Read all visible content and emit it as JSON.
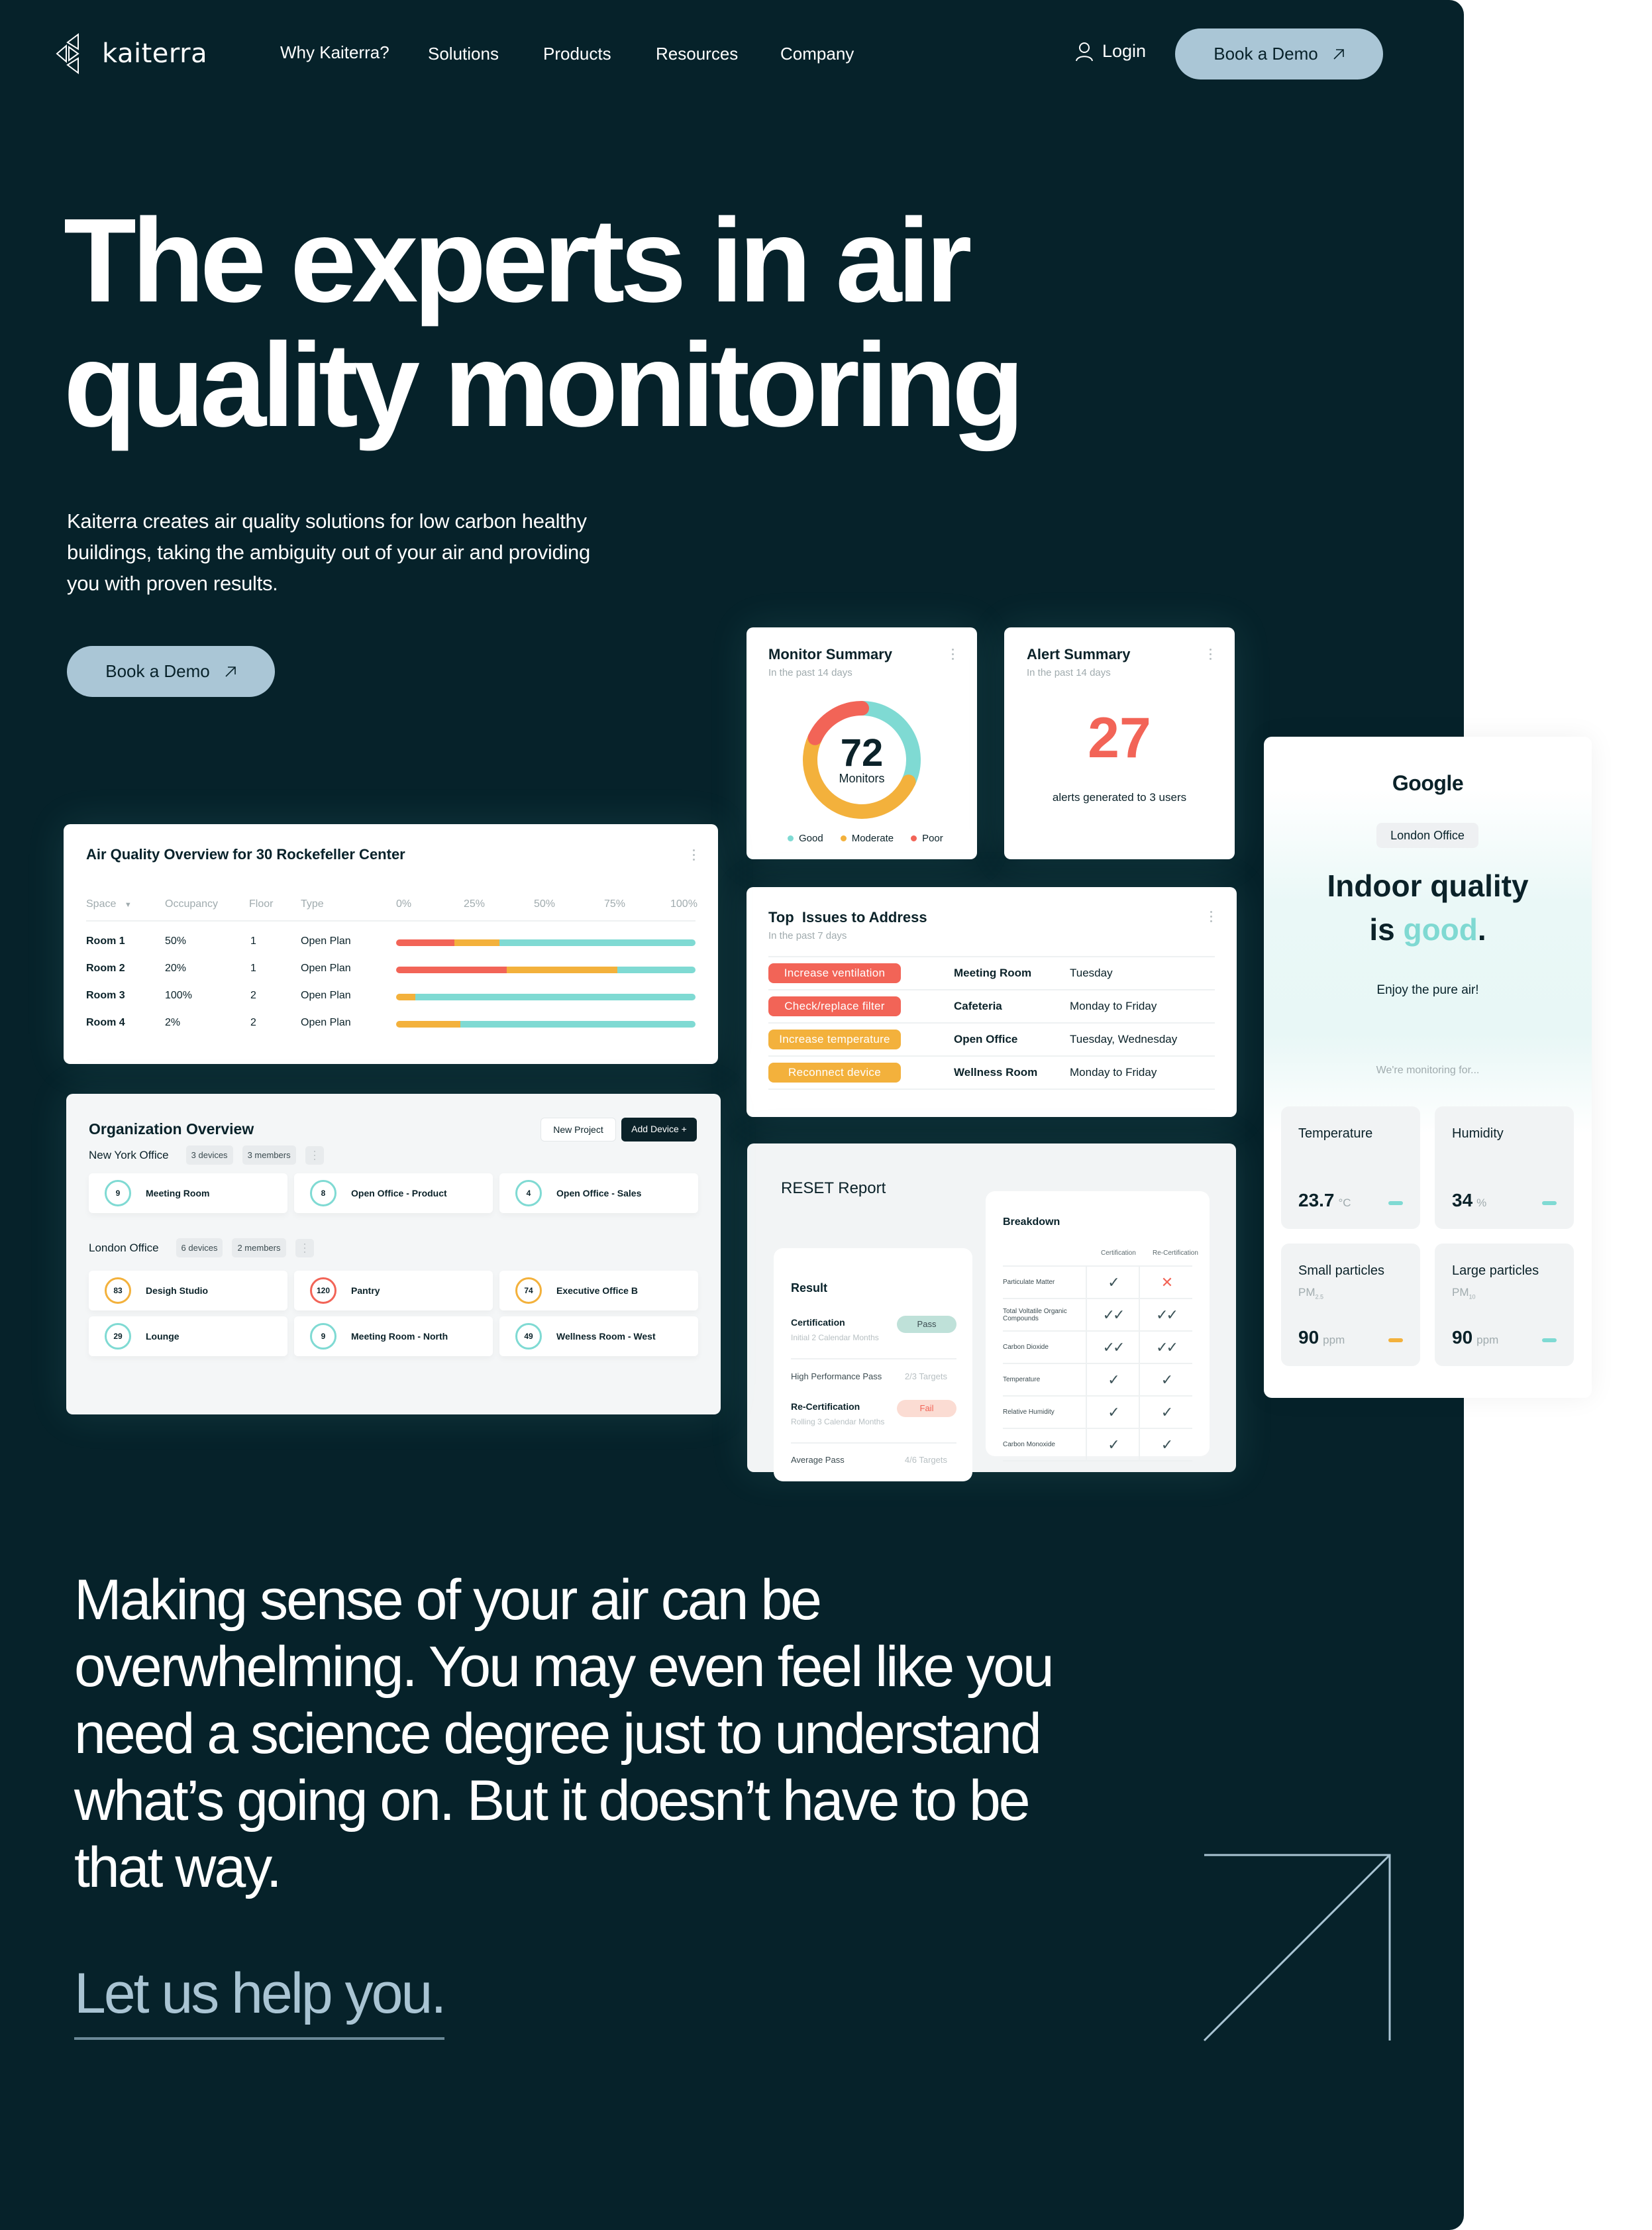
{
  "nav": {
    "brand": "kaiterra",
    "links": [
      "Why Kaiterra?",
      "Solutions",
      "Products",
      "Resources",
      "Company"
    ],
    "login": "Login",
    "cta": "Book a Demo"
  },
  "hero": {
    "title_line1": "The experts in air",
    "title_line2": "quality monitoring",
    "subtitle": "Kaiterra creates air quality solutions for low carbon healthy buildings, taking the ambiguity out of your air and providing you with proven results.",
    "cta": "Book a Demo"
  },
  "monitor_summary": {
    "title": "Monitor Summary",
    "subtitle": "In the past 14 days",
    "total": "72",
    "total_label": "Monitors",
    "segments": [
      {
        "name": "Good",
        "fraction": 0.32,
        "color": "#7fdad3"
      },
      {
        "name": "Moderate",
        "fraction": 0.5,
        "color": "#f3b13c"
      },
      {
        "name": "Poor",
        "fraction": 0.18,
        "color": "#f26457"
      }
    ]
  },
  "alert_summary": {
    "title": "Alert Summary",
    "subtitle": "In the past 14 days",
    "count": "27",
    "description": "alerts generated to 3 users"
  },
  "top_issues": {
    "title": "Top  Issues to Address",
    "subtitle": "In the past 7 days",
    "rows": [
      {
        "issue": "Increase ventilation",
        "severity": "poor",
        "location": "Meeting Room",
        "when": "Tuesday"
      },
      {
        "issue": "Check/replace filter",
        "severity": "poor",
        "location": "Cafeteria",
        "when": "Monday to Friday"
      },
      {
        "issue": "Increase temperature",
        "severity": "moderate",
        "location": "Open Office",
        "when": "Tuesday, Wednesday"
      },
      {
        "issue": "Reconnect device",
        "severity": "moderate",
        "location": "Wellness Room",
        "when": "Monday to Friday"
      }
    ]
  },
  "reset_report": {
    "title": "RESET Report",
    "result": {
      "title": "Result",
      "certification": {
        "label": "Certification",
        "sub": "Initial 2 Calendar Months",
        "status": "Pass"
      },
      "high_performance": {
        "label": "High Performance Pass",
        "value": "2/3 Targets"
      },
      "recertification": {
        "label": "Re-Certification",
        "sub": "Rolling 3 Calendar Months",
        "status": "Fail"
      },
      "average": {
        "label": "Average Pass",
        "value": "4/6 Targets"
      }
    },
    "breakdown": {
      "title": "Breakdown",
      "columns": [
        "Certification",
        "Re-Certification"
      ],
      "rows": [
        {
          "metric": "Particulate Matter",
          "cert": "✓",
          "recert": "✕"
        },
        {
          "metric": "Total Voltatile Organic Compounds",
          "cert": "✓✓",
          "recert": "✓✓"
        },
        {
          "metric": "Carbon Dioxide",
          "cert": "✓✓",
          "recert": "✓✓"
        },
        {
          "metric": "Temperature",
          "cert": "✓",
          "recert": "✓"
        },
        {
          "metric": "Relative Humidity",
          "cert": "✓",
          "recert": "✓"
        },
        {
          "metric": "Carbon Monoxide",
          "cert": "✓",
          "recert": "✓"
        }
      ]
    }
  },
  "google_card": {
    "brand": "Google",
    "office": "London Office",
    "headline_1": "Indoor quality",
    "headline_2_prefix": "is ",
    "headline_good": "good",
    "headline_suffix": ".",
    "enjoy": "Enjoy the pure air!",
    "monitoring": "We're monitoring for...",
    "tiles": [
      {
        "name": "Temperature",
        "sub": "",
        "sub_index": "",
        "value": "23.7",
        "unit": "°C",
        "status": "good"
      },
      {
        "name": "Humidity",
        "sub": "",
        "sub_index": "",
        "value": "34",
        "unit": "%",
        "status": "good"
      },
      {
        "name": "Small particles",
        "sub": "PM",
        "sub_index": "2.5",
        "value": "90",
        "unit": "ppm",
        "status": "moderate"
      },
      {
        "name": "Large particles",
        "sub": "PM",
        "sub_index": "10",
        "value": "90",
        "unit": "ppm",
        "status": "good"
      }
    ]
  },
  "air_quality_overview": {
    "title": "Air Quality Overview for 30 Rockefeller Center",
    "columns": [
      "Space",
      "Occupancy",
      "Floor",
      "Type"
    ],
    "scale": [
      "0%",
      "25%",
      "50%",
      "75%",
      "100%"
    ],
    "rows": [
      {
        "space": "Room 1",
        "occupancy": "50%",
        "floor": "1",
        "type": "Open Plan",
        "poor": 19.5,
        "moderate": 15,
        "good": 65.5
      },
      {
        "space": "Room 2",
        "occupancy": "20%",
        "floor": "1",
        "type": "Open Plan",
        "poor": 37,
        "moderate": 37,
        "good": 26
      },
      {
        "space": "Room 3",
        "occupancy": "100%",
        "floor": "2",
        "type": "Open Plan",
        "poor": 0,
        "moderate": 6.5,
        "good": 93.5
      },
      {
        "space": "Room 4",
        "occupancy": "2%",
        "floor": "2",
        "type": "Open Plan",
        "poor": 0,
        "moderate": 21.5,
        "good": 78.5
      }
    ]
  },
  "org_overview": {
    "title": "Organization Overview",
    "new_project": "New Project",
    "add_device": "Add Device +",
    "offices": [
      {
        "name": "New York Office",
        "devices": "3 devices",
        "members": "3 members",
        "rooms": [
          {
            "value": "9",
            "name": "Meeting Room",
            "status": "good"
          },
          {
            "value": "8",
            "name": "Open Office - Product",
            "status": "good"
          },
          {
            "value": "4",
            "name": "Open Office - Sales",
            "status": "good"
          }
        ]
      },
      {
        "name": "London Office",
        "devices": "6 devices",
        "members": "2 members",
        "rooms": [
          {
            "value": "83",
            "name": "Desigh Studio",
            "status": "moderate"
          },
          {
            "value": "120",
            "name": "Pantry",
            "status": "poor"
          },
          {
            "value": "74",
            "name": "Executive Office B",
            "status": "moderate"
          },
          {
            "value": "29",
            "name": "Lounge",
            "status": "good"
          },
          {
            "value": "9",
            "name": "Meeting Room - North",
            "status": "good"
          },
          {
            "value": "49",
            "name": "Wellness Room - West",
            "status": "good"
          }
        ]
      }
    ]
  },
  "statement": {
    "text": "Making sense of your air can be overwhelming. You may even feel like you need a science degree just to understand what’s going on. But it doesn’t have to be that way.",
    "cta": "Let us help you."
  },
  "colors": {
    "background": "#06222a",
    "accent": "#aac6d6",
    "good": "#7fdad3",
    "moderate": "#f3b13c",
    "poor": "#f26457"
  }
}
